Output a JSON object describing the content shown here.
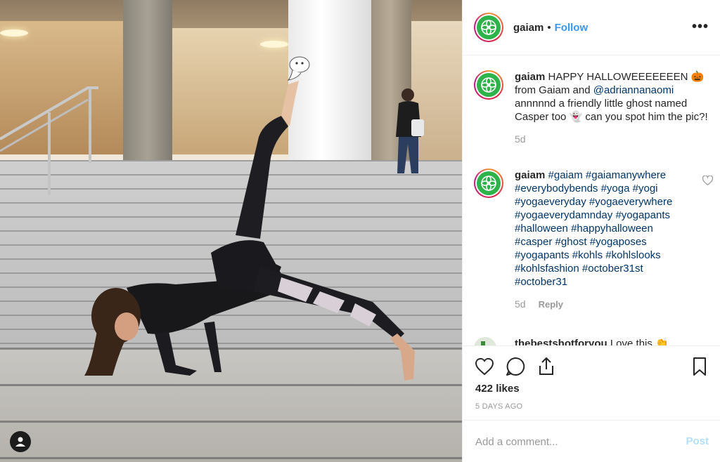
{
  "colors": {
    "accent": "#3897f0",
    "hashtag": "#003569",
    "muted": "#999999",
    "brand_logo": "#2db34a",
    "post_disabled": "#b2dffc"
  },
  "header": {
    "username": "gaiam",
    "separator": "•",
    "follow_label": "Follow",
    "more_label": "•••"
  },
  "caption": {
    "username": "gaiam",
    "text_1": " HAPPY HALLOWEEEEEEEN 🎃 from Gaiam and ",
    "mention": "@adriannanaomi",
    "text_2": " annnnnd a friendly little ghost named Casper too 👻 can you spot him the pic?!",
    "time": "5d"
  },
  "tags_comment": {
    "username": "gaiam",
    "tags": [
      "#gaiam",
      "#gaiamanywhere",
      "#everybodybends",
      "#yoga",
      "#yogi",
      "#yogaeveryday",
      "#yogaeverywhere",
      "#yogaeverydamnday",
      "#yogapants",
      "#halloween",
      "#happyhalloween",
      "#casper",
      "#ghost",
      "#yogaposes",
      "#yogapants",
      "#kohls",
      "#kohlslooks",
      "#kohlsfashion",
      "#october31st",
      "#october31"
    ],
    "time": "5d",
    "reply_label": "Reply"
  },
  "partial_comment": {
    "username": "thebestshotforyou",
    "text": " Love this 👏"
  },
  "icons": {
    "like": "heart-icon",
    "comment": "comment-bubble-icon",
    "share": "share-icon",
    "save": "bookmark-icon",
    "profile": "user-icon"
  },
  "stats": {
    "likes": "422 likes",
    "date": "5 DAYS AGO"
  },
  "add_comment": {
    "placeholder": "Add a comment...",
    "post_label": "Post"
  }
}
